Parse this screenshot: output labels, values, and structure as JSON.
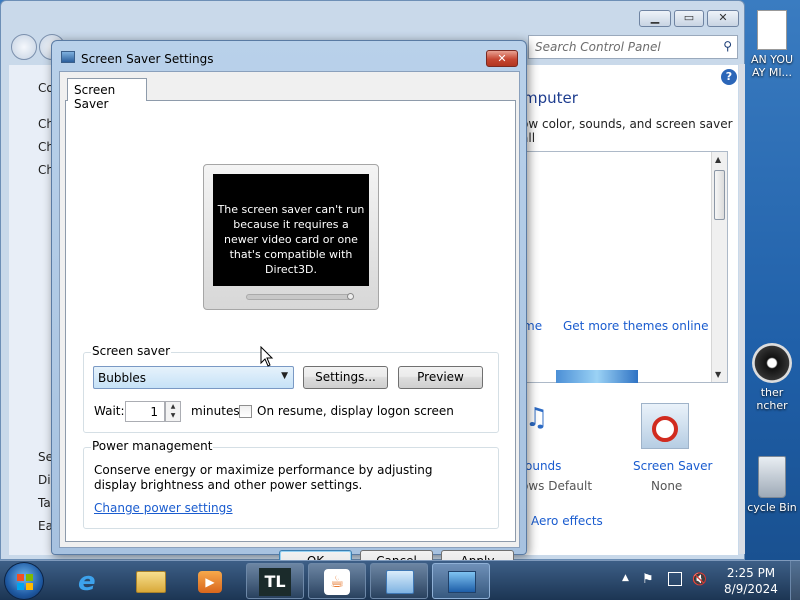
{
  "desktop": {
    "icon_top_label_1": "AN YOU",
    "icon_top_label_2": "AY MI...",
    "icon_mid_label_1": "ther",
    "icon_mid_label_2": "ncher",
    "recycle_label": "cycle Bin"
  },
  "control_panel": {
    "search_placeholder": "Search Control Panel",
    "left_items": [
      "Co",
      "Ch",
      "Ch",
      "Ch"
    ],
    "left_bottom_items": [
      "Se",
      "Dis",
      "Ta",
      "Ea"
    ],
    "heading": "mputer",
    "subtitle": "ow color, sounds, and screen saver all",
    "theme_link_left": "me",
    "get_more_themes": "Get more themes online",
    "sounds_label": "ounds",
    "sounds_value": "ows Default",
    "screen_saver_label": "Screen Saver",
    "screen_saver_value": "None",
    "aero_effects": "Aero effects"
  },
  "dialog": {
    "title": "Screen Saver Settings",
    "tab": "Screen Saver",
    "preview_message": "The screen saver can't run because it requires a newer video card or one that's compatible with Direct3D.",
    "screen_saver_group": "Screen saver",
    "selected_saver": "Bubbles",
    "settings_button": "Settings...",
    "preview_button": "Preview",
    "wait_label": "Wait:",
    "wait_value": "1",
    "minutes_label": "minutes",
    "on_resume_label": "On resume, display logon screen",
    "on_resume_checked": false,
    "power_group": "Power management",
    "power_text": "Conserve energy or maximize performance by adjusting display brightness and other power settings.",
    "power_link": "Change power settings",
    "ok_button": "OK",
    "cancel_button": "Cancel",
    "apply_button": "Apply"
  },
  "taskbar": {
    "pinned": [
      "start-button",
      "internet-explorer",
      "windows-explorer",
      "media-player",
      "tl-app",
      "java-app",
      "control-panel",
      "screen-saver-settings"
    ],
    "tl_label": "TL",
    "time": "2:25 PM",
    "date": "8/9/2024"
  }
}
